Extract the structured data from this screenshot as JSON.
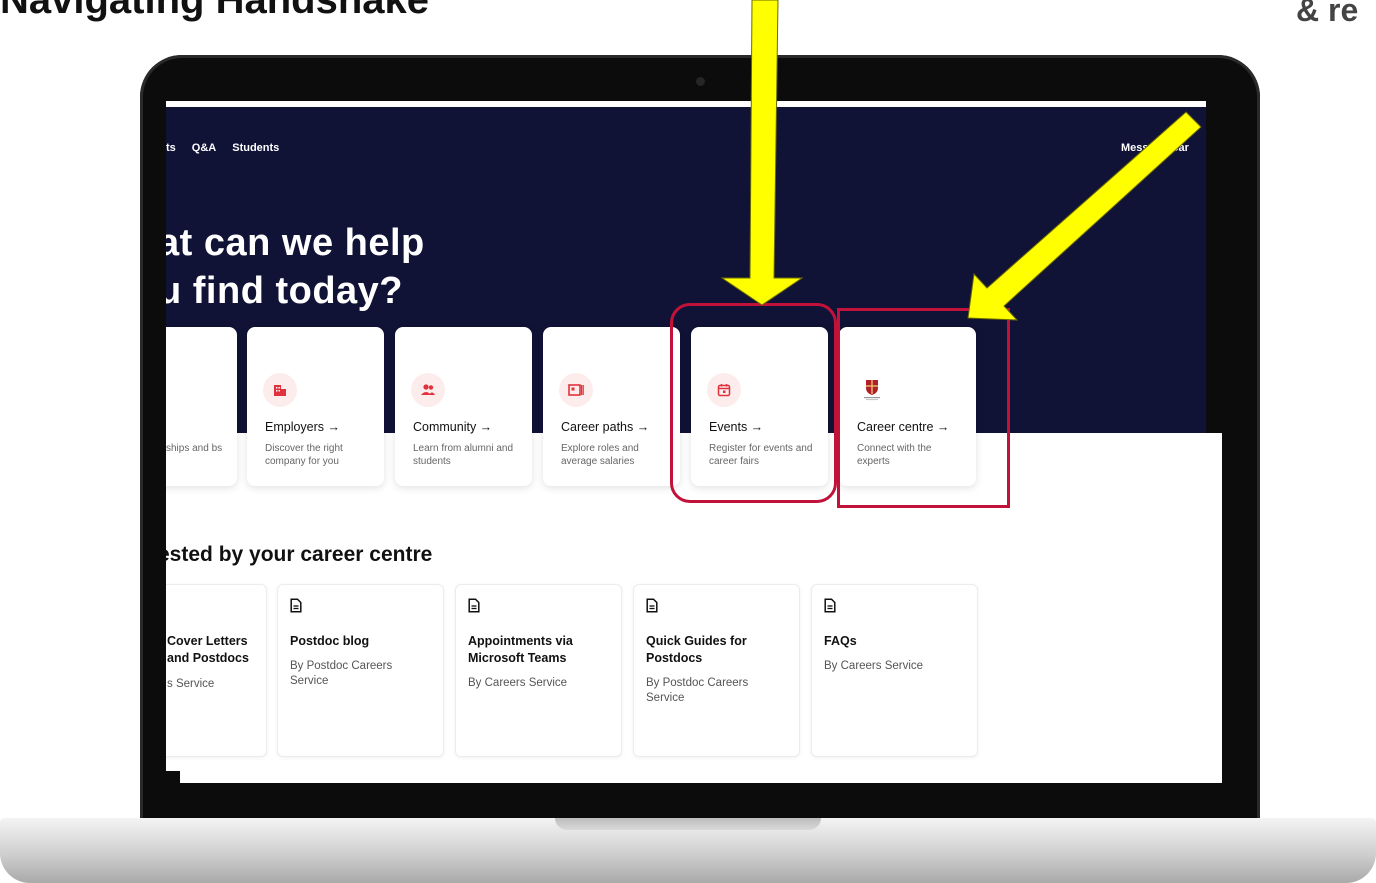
{
  "slide": {
    "title": "Navigating Handshake",
    "corner_text": "& re"
  },
  "nav": {
    "items": [
      "ts",
      "Q&A",
      "Students"
    ],
    "right_items": [
      "Mess",
      "Car"
    ]
  },
  "hero": {
    "title_line1": "at can we help",
    "title_line2": "u find today?"
  },
  "cards": [
    {
      "title": "",
      "desc": "ships and bs"
    },
    {
      "title": "Employers →",
      "desc": "Discover the right company for you",
      "icon": "building-icon"
    },
    {
      "title": "Community →",
      "desc": "Learn from alumni and students",
      "icon": "people-icon"
    },
    {
      "title": "Career paths →",
      "desc": "Explore roles and average salaries",
      "icon": "id-card-icon"
    },
    {
      "title": "Events →",
      "desc": "Register for events and career fairs",
      "icon": "calendar-icon"
    },
    {
      "title": "Career centre →",
      "desc": "Connect with the experts",
      "icon": "university-crest-icon"
    }
  ],
  "section": {
    "title": "ested by your career centre"
  },
  "resources": [
    {
      "title": "Cover Letters and Postdocs",
      "by": "s Service"
    },
    {
      "title": "Postdoc blog",
      "by": "By Postdoc Careers Service"
    },
    {
      "title": "Appointments via Microsoft Teams",
      "by": "By Careers Service"
    },
    {
      "title": "Quick Guides for Postdocs",
      "by": "By Postdoc Careers Service"
    },
    {
      "title": "FAQs",
      "by": "By Careers Service"
    }
  ],
  "colors": {
    "hero_bg": "#101236",
    "icon_red": "#e0323c",
    "icon_bg": "#fdecec",
    "highlight": "#c3123a",
    "arrow": "#ffff00"
  }
}
